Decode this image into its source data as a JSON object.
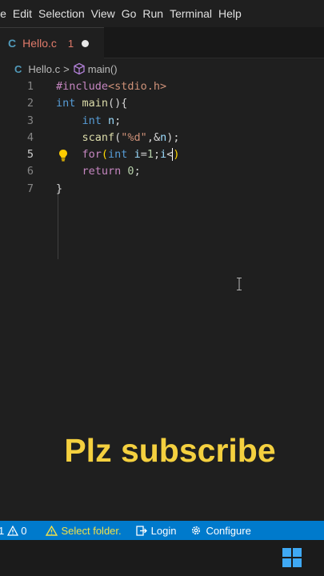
{
  "menu": [
    "le",
    "Edit",
    "Selection",
    "View",
    "Go",
    "Run",
    "Terminal",
    "Help"
  ],
  "tab": {
    "icon": "C",
    "name": "Hello.c",
    "count": "1"
  },
  "breadcrumb": {
    "icon": "C",
    "file": "Hello.c",
    "separator": ">",
    "symbol": "main()"
  },
  "editor": {
    "line_numbers": [
      "1",
      "2",
      "3",
      "4",
      "5",
      "6",
      "7"
    ],
    "lines": [
      [
        {
          "t": "#include",
          "c": "pp"
        },
        {
          "t": "<stdio.h>",
          "c": "str"
        }
      ],
      [
        {
          "t": "int ",
          "c": "kw"
        },
        {
          "t": "main",
          "c": "fn"
        },
        {
          "t": "(){",
          "c": "pn"
        }
      ],
      [
        {
          "t": "    ",
          "c": "pn"
        },
        {
          "t": "int ",
          "c": "kw"
        },
        {
          "t": "n",
          "c": "var"
        },
        {
          "t": ";",
          "c": "pn"
        }
      ],
      [
        {
          "t": "    ",
          "c": "pn"
        },
        {
          "t": "scanf",
          "c": "fn"
        },
        {
          "t": "(",
          "c": "pn"
        },
        {
          "t": "\"%d\"",
          "c": "str"
        },
        {
          "t": ",&",
          "c": "pn"
        },
        {
          "t": "n",
          "c": "var"
        },
        {
          "t": ");",
          "c": "pn"
        }
      ],
      [
        {
          "t": "    ",
          "c": "pn"
        },
        {
          "t": "for",
          "c": "pp"
        },
        {
          "t": "(",
          "c": "br"
        },
        {
          "t": "int ",
          "c": "kw"
        },
        {
          "t": "i",
          "c": "var"
        },
        {
          "t": "=",
          "c": "pn"
        },
        {
          "t": "1",
          "c": "num"
        },
        {
          "t": ";",
          "c": "pn"
        },
        {
          "t": "i",
          "c": "var"
        },
        {
          "t": "<",
          "c": "pn"
        },
        {
          "caret": true
        },
        {
          "t": ")",
          "c": "br"
        }
      ],
      [
        {
          "t": "    ",
          "c": "pn"
        },
        {
          "t": "return ",
          "c": "pp"
        },
        {
          "t": "0",
          "c": "num"
        },
        {
          "t": ";",
          "c": "pn"
        }
      ],
      [
        {
          "t": "}",
          "c": "pn"
        }
      ]
    ]
  },
  "overlay_text": "Plz subscribe",
  "status": {
    "problems_errors": "1",
    "problems_warnings": "0",
    "select_folder": "Select folder.",
    "login": "Login",
    "configure": "Configure"
  },
  "colors": {
    "statusbar": "#007acc",
    "editor_bg": "#1f1f1f",
    "overlay_text": "#f4d03f"
  }
}
